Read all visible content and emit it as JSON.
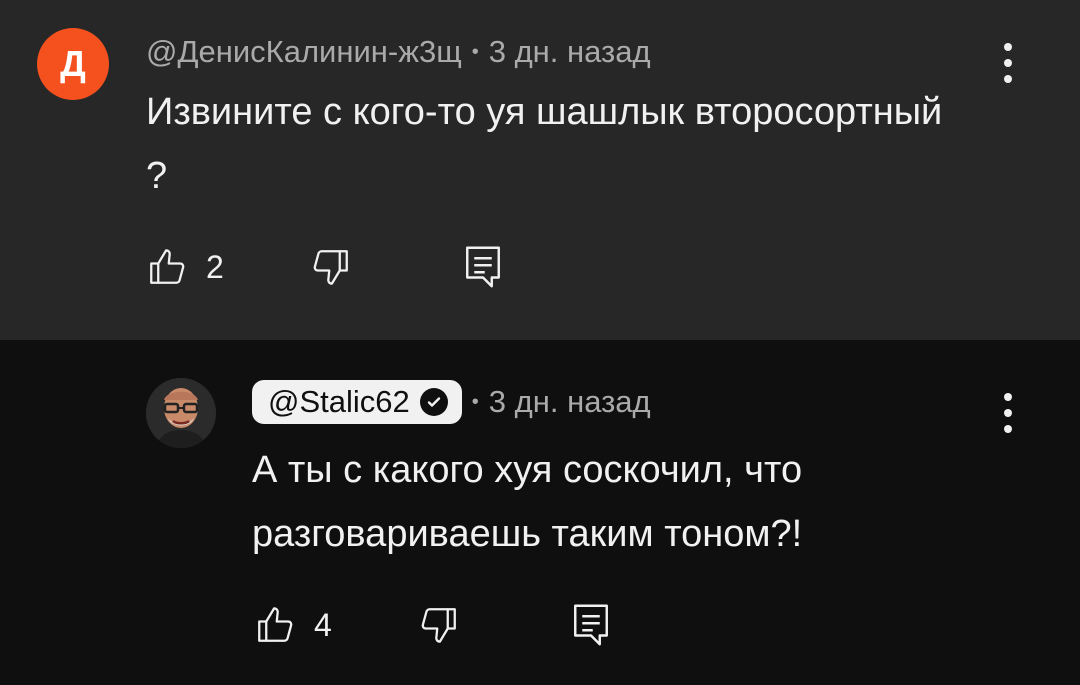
{
  "comment": {
    "avatar_letter": "Д",
    "author": "@ДенисКалинин-ж3щ",
    "separator": "•",
    "time": "3 дн. назад",
    "text": "Извините с кого-то уя шашлык второсортный ?",
    "likes": "2"
  },
  "reply": {
    "author": "@Stalic62",
    "separator": "•",
    "time": "3 дн. назад",
    "text": "А ты с какого хуя соскочил, что разговариваешь таким тоном?!",
    "likes": "4"
  },
  "colors": {
    "top_background": "#272727",
    "reply_background": "#0f0f0f",
    "avatar_letter_bg": "#f4511e",
    "text": "#f1f1f1",
    "meta": "#aaaaaa"
  },
  "icons": [
    "thumb-up-icon",
    "thumb-down-icon",
    "reply-icon",
    "more-vert-icon",
    "verified-check-icon"
  ]
}
